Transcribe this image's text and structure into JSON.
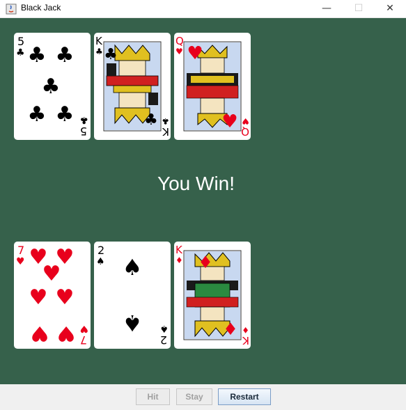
{
  "window": {
    "title": "Black Jack",
    "controls": {
      "minimize": "—",
      "maximize": "☐",
      "close": "✕"
    }
  },
  "colors": {
    "table": "#36614b",
    "red_suit": "#e8001c",
    "black_suit": "#000000"
  },
  "dealer_hand": [
    {
      "rank": "5",
      "suit": "clubs",
      "suit_symbol": "♣"
    },
    {
      "rank": "K",
      "suit": "clubs",
      "suit_symbol": "♣"
    },
    {
      "rank": "Q",
      "suit": "hearts",
      "suit_symbol": "♥"
    }
  ],
  "player_hand": [
    {
      "rank": "7",
      "suit": "hearts",
      "suit_symbol": "♥"
    },
    {
      "rank": "2",
      "suit": "spades",
      "suit_symbol": "♠"
    },
    {
      "rank": "K",
      "suit": "diamonds",
      "suit_symbol": "♦"
    }
  ],
  "result_text": "You Win!",
  "buttons": {
    "hit": "Hit",
    "stay": "Stay",
    "restart": "Restart"
  }
}
